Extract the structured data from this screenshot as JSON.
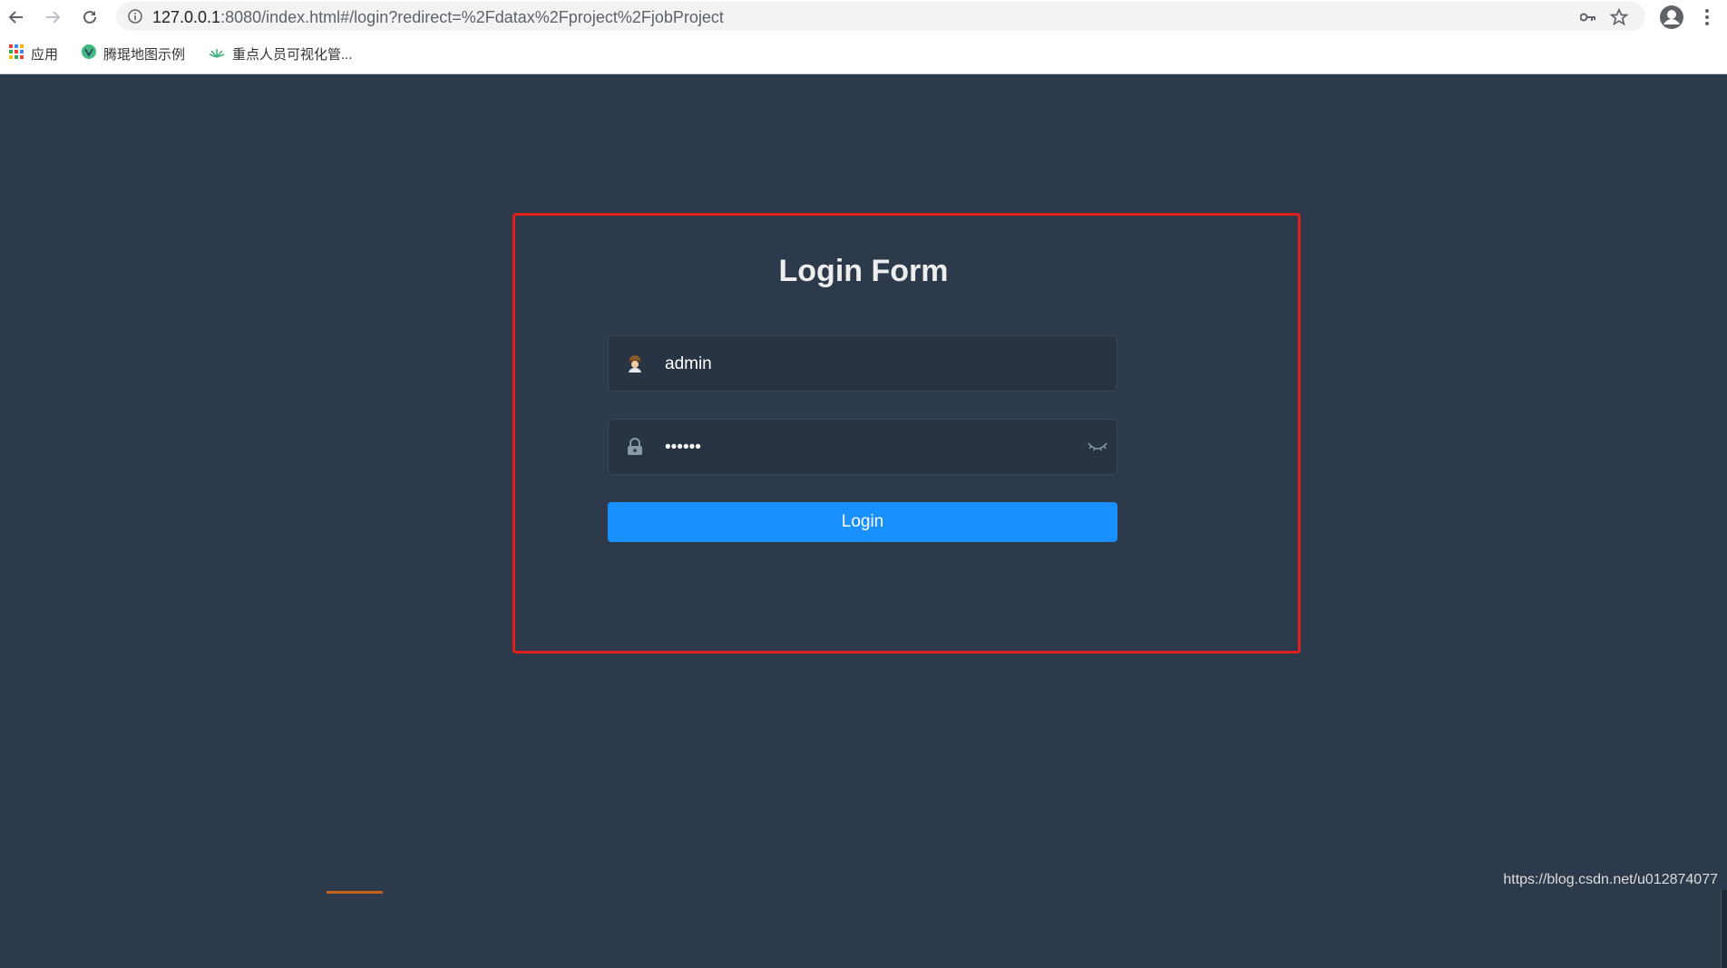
{
  "browser": {
    "url_host": "127.0.0.1",
    "url_rest": ":8080/index.html#/login?redirect=%2Fdatax%2Fproject%2FjobProject"
  },
  "bookmarks": [
    {
      "label": "应用",
      "icon": "apps-grid-icon"
    },
    {
      "label": "腾琨地图示例",
      "icon": "vue-icon"
    },
    {
      "label": "重点人员可视化管...",
      "icon": "leaf-icon"
    }
  ],
  "login": {
    "title": "Login Form",
    "username": "admin",
    "password_mask": "••••••",
    "button_label": "Login"
  },
  "watermark": "https://blog.csdn.net/u012874077",
  "colors": {
    "page_bg": "#2d3a4b",
    "input_bg": "#283443",
    "button_bg": "#1890ff",
    "highlight": "#e0201b"
  }
}
